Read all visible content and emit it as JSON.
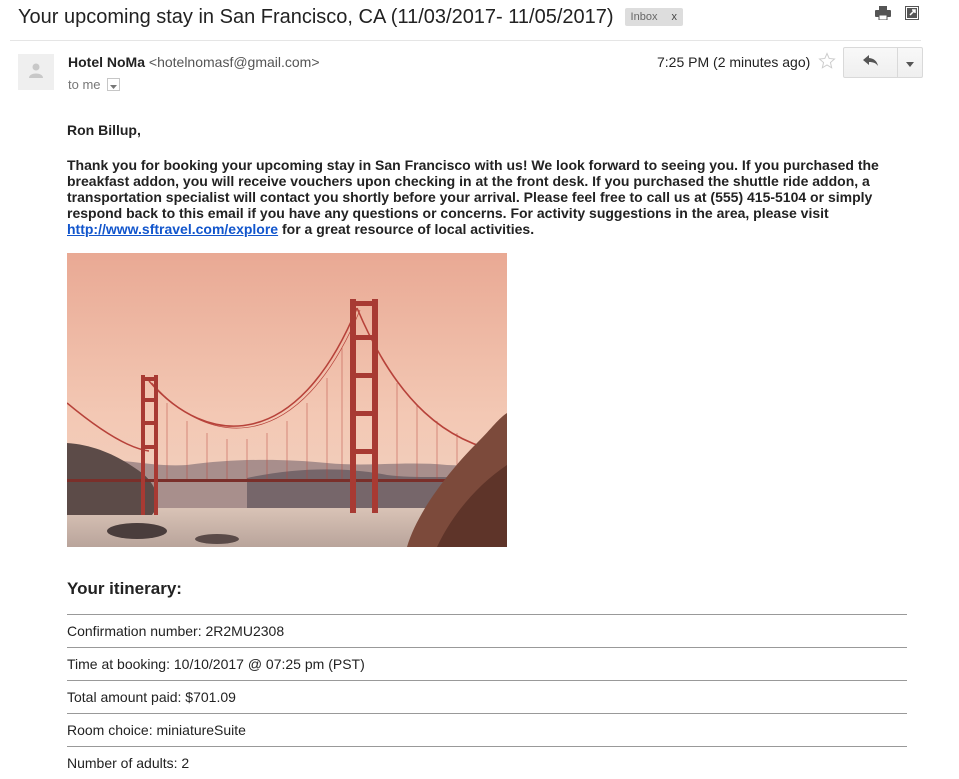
{
  "email": {
    "subject": "Your upcoming stay in San Francisco, CA (11/03/2017- 11/05/2017)",
    "label": "Inbox",
    "label_remove": "x",
    "sender_name": "Hotel NoMa",
    "sender_email": "<hotelnomasf@gmail.com>",
    "recipient": "to me",
    "time": "7:25 PM (2 minutes ago)",
    "greeting": "Ron Billup,",
    "body_text": "Thank you for booking your upcoming stay in San Francisco with us! We look forward to seeing you. If you purchased the breakfast addon, you will receive vouchers upon checking in at the front desk. If you purchased the shuttle ride addon, a transportation specialist will contact you shortly before your arrival. Please feel free to call us at (555) 415-5104 or simply respond back to this email if you have any questions or concerns. For activity suggestions in the area, please visit ",
    "link_text": "http://www.sftravel.com/explore",
    "body_tail": " for a great resource of local activities."
  },
  "icons": {
    "print": "print-icon",
    "popout": "new-window-icon",
    "star": "star-icon",
    "reply": "reply-icon",
    "more": "chevron-down-icon",
    "avatar": "person-icon"
  },
  "itinerary": {
    "title": "Your itinerary:",
    "rows": [
      "Confirmation number: 2R2MU2308",
      "Time at booking: 10/10/2017 @ 07:25 pm (PST)",
      "Total amount paid: $701.09",
      "Room choice: miniatureSuite",
      "Number of adults: 2"
    ]
  }
}
